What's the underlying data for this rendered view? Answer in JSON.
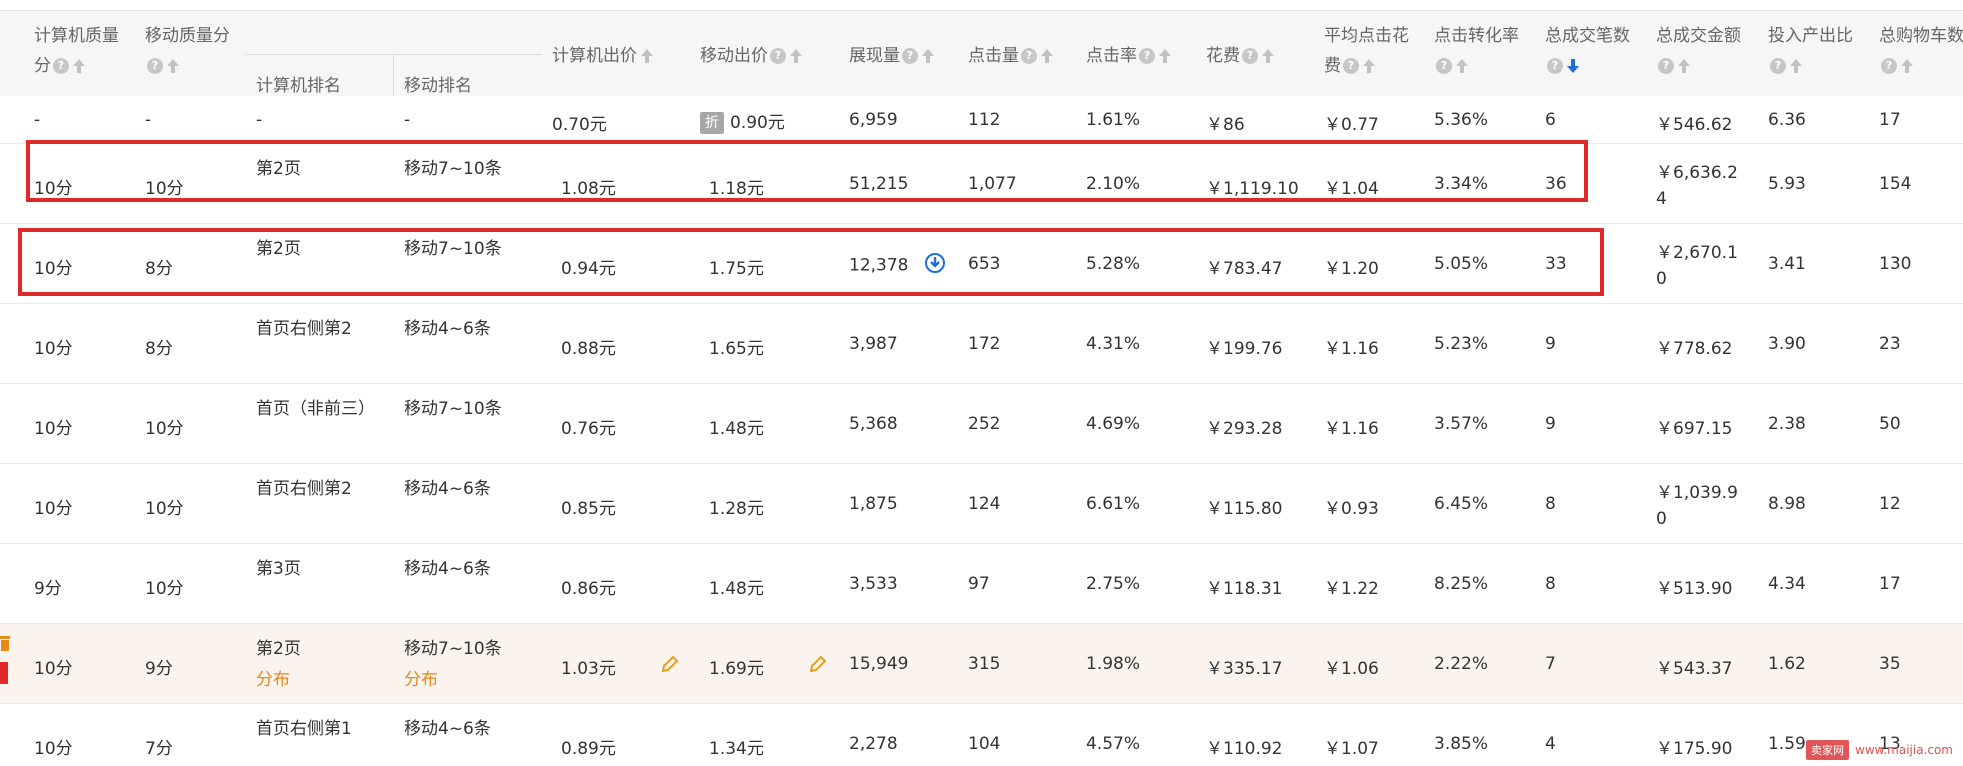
{
  "header": {
    "pc_quality": [
      "计算机质量",
      "分"
    ],
    "mobile_quality": "移动质量分",
    "pc_rank": "计算机排名",
    "mobile_rank": "移动排名",
    "pc_bid": "计算机出价",
    "mobile_bid": "移动出价",
    "impressions": "展现量",
    "clicks": "点击量",
    "ctr": "点击率",
    "cost": "花费",
    "avg_cpc": [
      "平均点击花",
      "费"
    ],
    "cvr": "点击转化率",
    "orders": "总成交笔数",
    "gmv": "总成交金额",
    "roi": "投入产出比",
    "cart": "总购物车数"
  },
  "summary_row": {
    "pc_quality": "-",
    "mobile_quality": "-",
    "pc_rank": "-",
    "mobile_rank": "-",
    "pc_bid": "0.70元",
    "discount": "折",
    "mobile_bid": "0.90元",
    "impressions": "6,959",
    "clicks": "112",
    "ctr": "1.61%",
    "cost": "￥86",
    "avg_cpc": "￥0.77",
    "cvr": "5.36%",
    "orders": "6",
    "gmv": "￥546.62",
    "roi": "6.36",
    "cart": "17"
  },
  "rows": [
    {
      "pc_quality": "10分",
      "mobile_quality": "10分",
      "pc_rank": "第2页",
      "mobile_rank": "移动7~10条",
      "pc_bid": "1.08元",
      "mobile_bid": "1.18元",
      "impressions": "51,215",
      "clicks": "1,077",
      "ctr": "2.10%",
      "cost": "￥1,119.10",
      "avg_cpc": "￥1.04",
      "cvr": "3.34%",
      "orders": "36",
      "gmv": [
        "￥6,636.2",
        "4"
      ],
      "roi": "5.93",
      "cart": "154"
    },
    {
      "pc_quality": "10分",
      "mobile_quality": "8分",
      "pc_rank": "第2页",
      "mobile_rank": "移动7~10条",
      "pc_bid": "0.94元",
      "mobile_bid": "1.75元",
      "impressions": "12,378",
      "clicks": "653",
      "ctr": "5.28%",
      "cost": "￥783.47",
      "avg_cpc": "￥1.20",
      "cvr": "5.05%",
      "orders": "33",
      "gmv": [
        "￥2,670.1",
        "0"
      ],
      "roi": "3.41",
      "cart": "130"
    },
    {
      "pc_quality": "10分",
      "mobile_quality": "8分",
      "pc_rank": "首页右侧第2",
      "mobile_rank": "移动4~6条",
      "pc_bid": "0.88元",
      "mobile_bid": "1.65元",
      "impressions": "3,987",
      "clicks": "172",
      "ctr": "4.31%",
      "cost": "￥199.76",
      "avg_cpc": "￥1.16",
      "cvr": "5.23%",
      "orders": "9",
      "gmv": [
        "￥778.62",
        ""
      ],
      "roi": "3.90",
      "cart": "23"
    },
    {
      "pc_quality": "10分",
      "mobile_quality": "10分",
      "pc_rank": "首页（非前三）",
      "mobile_rank": "移动7~10条",
      "pc_bid": "0.76元",
      "mobile_bid": "1.48元",
      "impressions": "5,368",
      "clicks": "252",
      "ctr": "4.69%",
      "cost": "￥293.28",
      "avg_cpc": "￥1.16",
      "cvr": "3.57%",
      "orders": "9",
      "gmv": [
        "￥697.15",
        ""
      ],
      "roi": "2.38",
      "cart": "50"
    },
    {
      "pc_quality": "10分",
      "mobile_quality": "10分",
      "pc_rank": "首页右侧第2",
      "mobile_rank": "移动4~6条",
      "pc_bid": "0.85元",
      "mobile_bid": "1.28元",
      "impressions": "1,875",
      "clicks": "124",
      "ctr": "6.61%",
      "cost": "￥115.80",
      "avg_cpc": "￥0.93",
      "cvr": "6.45%",
      "orders": "8",
      "gmv": [
        "￥1,039.9",
        "0"
      ],
      "roi": "8.98",
      "cart": "12"
    },
    {
      "pc_quality": "9分",
      "mobile_quality": "10分",
      "pc_rank": "第3页",
      "mobile_rank": "移动4~6条",
      "pc_bid": "0.86元",
      "mobile_bid": "1.48元",
      "impressions": "3,533",
      "clicks": "97",
      "ctr": "2.75%",
      "cost": "￥118.31",
      "avg_cpc": "￥1.22",
      "cvr": "8.25%",
      "orders": "8",
      "gmv": [
        "￥513.90",
        ""
      ],
      "roi": "4.34",
      "cart": "17"
    },
    {
      "pc_quality": "10分",
      "mobile_quality": "9分",
      "pc_rank": "第2页",
      "mobile_rank": "移动7~10条",
      "pc_rank_link": "分布",
      "mobile_rank_link": "分布",
      "pc_bid": "1.03元",
      "mobile_bid": "1.69元",
      "impressions": "15,949",
      "clicks": "315",
      "ctr": "1.98%",
      "cost": "￥335.17",
      "avg_cpc": "￥1.06",
      "cvr": "2.22%",
      "orders": "7",
      "gmv": [
        "￥543.37",
        ""
      ],
      "roi": "1.62",
      "cart": "35"
    },
    {
      "pc_quality": "10分",
      "mobile_quality": "7分",
      "pc_rank": "首页右侧第1",
      "mobile_rank": "移动4~6条",
      "pc_bid": "0.89元",
      "mobile_bid": "1.34元",
      "impressions": "2,278",
      "clicks": "104",
      "ctr": "4.57%",
      "cost": "￥110.92",
      "avg_cpc": "￥1.07",
      "cvr": "3.85%",
      "orders": "4",
      "gmv": [
        "￥175.90",
        ""
      ],
      "roi": "1.59",
      "cart": "13"
    }
  ],
  "watermark": {
    "badge": "卖家网",
    "url": "www.maijia.com"
  },
  "colors": {
    "highlight_border": "#e02a2a",
    "hover_row": "#fbf3ee",
    "link": "#e88a1a",
    "sort_active": "#1e6fd9"
  }
}
